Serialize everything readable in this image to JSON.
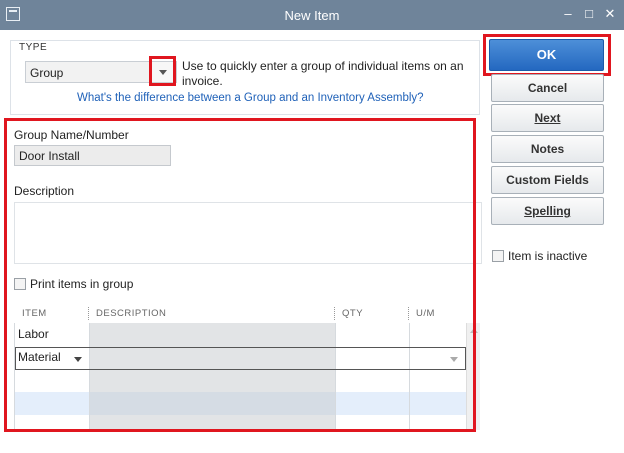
{
  "window": {
    "title": "New Item",
    "minimize": "–",
    "maximize": "□",
    "close": "✕"
  },
  "type_section": {
    "label": "TYPE",
    "selected": "Group",
    "description": "Use to quickly enter a group of individual items on an invoice.",
    "help_link": "What's the difference between a Group and an Inventory Assembly?"
  },
  "form": {
    "group_name_label": "Group Name/Number",
    "group_name_value": "Door Install",
    "description_label": "Description",
    "description_value": "",
    "print_items_label": "Print items in group"
  },
  "grid": {
    "columns": [
      "ITEM",
      "DESCRIPTION",
      "QTY",
      "U/M"
    ],
    "rows": [
      {
        "item": "Labor",
        "description": "",
        "qty": "",
        "um": ""
      },
      {
        "item": "Material",
        "description": "",
        "qty": "",
        "um": ""
      }
    ]
  },
  "buttons": {
    "ok": "OK",
    "cancel": "Cancel",
    "next": "Next",
    "notes": "Notes",
    "custom_fields": "Custom Fields",
    "spelling": "Spelling"
  },
  "inactive_label": "Item is inactive",
  "colors": {
    "highlight": "#e0161f",
    "titlebar": "#6f849a",
    "ok_button": "#2f75c8",
    "link": "#1f61b8"
  }
}
